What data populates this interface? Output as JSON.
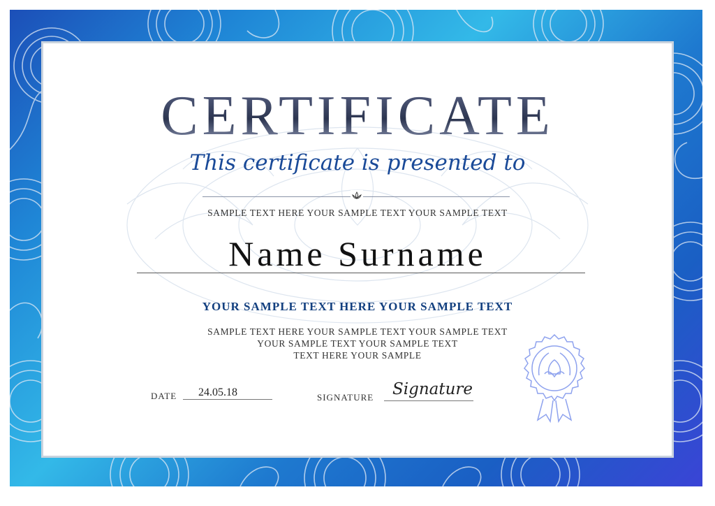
{
  "certificate": {
    "title": "CERTIFICATE",
    "subtitle": "This certificate is presented to",
    "sample_line": "SAMPLE TEXT HERE YOUR SAMPLE TEXT YOUR SAMPLE TEXT",
    "name": "Name Surname",
    "bold_line": "YOUR SAMPLE TEXT HERE YOUR SAMPLE TEXT",
    "paragraph": [
      "SAMPLE TEXT HERE YOUR SAMPLE TEXT YOUR SAMPLE TEXT",
      "YOUR SAMPLE TEXT YOUR SAMPLE TEXT",
      "TEXT HERE YOUR SAMPLE"
    ],
    "date_label": "DATE",
    "date_value": "24.05.18",
    "signature_label": "SIGNATURE",
    "signature_value": "Signature"
  },
  "colors": {
    "border_accent": "#1f86d6",
    "subtitle": "#1a4a98",
    "bold_line": "#123f7f",
    "seal": "#7f95e8"
  },
  "icons": {
    "ornament": "lotus-ornament-icon",
    "seal": "seal-icon"
  }
}
